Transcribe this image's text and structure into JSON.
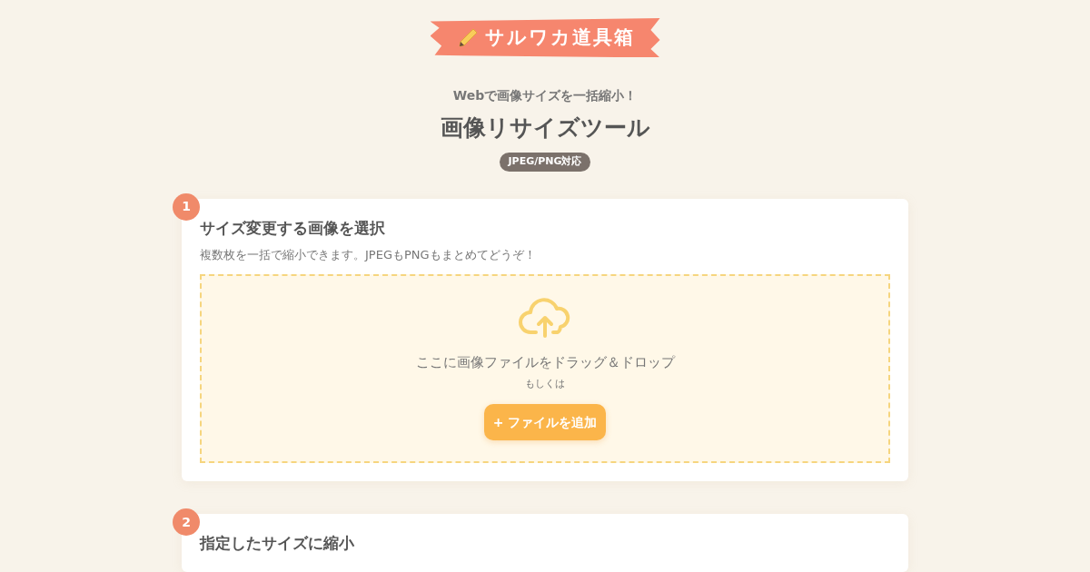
{
  "logo": {
    "text": "サルワカ道具箱"
  },
  "header": {
    "tagline": "Webで画像サイズを一括縮小！",
    "title": "画像リサイズツール",
    "badge": "JPEG/PNG対応"
  },
  "steps": [
    {
      "number": "1",
      "title": "サイズ変更する画像を選択",
      "description": "複数枚を一括で縮小できます。JPEGもPNGもまとめてどうぞ！",
      "dropzone": {
        "prompt": "ここに画像ファイルをドラッグ＆ドロップ",
        "or": "もしくは",
        "button": "+ ファイルを追加"
      }
    },
    {
      "number": "2",
      "title": "指定したサイズに縮小"
    }
  ]
}
